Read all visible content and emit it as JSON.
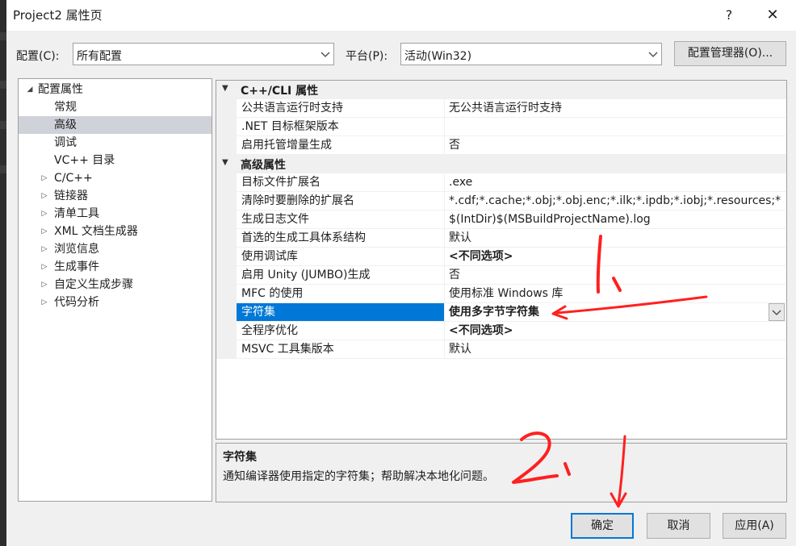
{
  "window": {
    "title": "Project2 属性页",
    "help_label": "?",
    "close_label": "✕"
  },
  "config_bar": {
    "config_label": "配置(C):",
    "config_value": "所有配置",
    "platform_label": "平台(P):",
    "platform_value": "活动(Win32)",
    "manager_button": "配置管理器(O)..."
  },
  "tree": {
    "root": "配置属性",
    "items": [
      {
        "label": "常规"
      },
      {
        "label": "高级"
      },
      {
        "label": "调试"
      },
      {
        "label": "VC++ 目录"
      },
      {
        "label": "C/C++"
      },
      {
        "label": "链接器"
      },
      {
        "label": "清单工具"
      },
      {
        "label": "XML 文档生成器"
      },
      {
        "label": "浏览信息"
      },
      {
        "label": "生成事件"
      },
      {
        "label": "自定义生成步骤"
      },
      {
        "label": "代码分析"
      }
    ]
  },
  "grid": {
    "sections": [
      {
        "title": "C++/CLI 属性",
        "rows": [
          {
            "name": "公共语言运行时支持",
            "value": "无公共语言运行时支持"
          },
          {
            "name": ".NET 目标框架版本",
            "value": ""
          },
          {
            "name": "启用托管增量生成",
            "value": "否"
          }
        ]
      },
      {
        "title": "高级属性",
        "rows": [
          {
            "name": "目标文件扩展名",
            "value": ".exe"
          },
          {
            "name": "清除时要删除的扩展名",
            "value": "*.cdf;*.cache;*.obj;*.obj.enc;*.ilk;*.ipdb;*.iobj;*.resources;*"
          },
          {
            "name": "生成日志文件",
            "value": "$(IntDir)$(MSBuildProjectName).log"
          },
          {
            "name": "首选的生成工具体系结构",
            "value": "默认"
          },
          {
            "name": "使用调试库",
            "value": "<不同选项>"
          },
          {
            "name": "启用 Unity (JUMBO)生成",
            "value": "否"
          },
          {
            "name": "MFC 的使用",
            "value": "使用标准 Windows 库"
          },
          {
            "name": "字符集",
            "value": "使用多字节字符集"
          },
          {
            "name": "全程序优化",
            "value": "<不同选项>"
          },
          {
            "name": "MSVC 工具集版本",
            "value": "默认"
          }
        ]
      }
    ]
  },
  "description": {
    "title": "字符集",
    "text": "通知编译器使用指定的字符集；帮助解决本地化问题。"
  },
  "buttons": {
    "ok": "确定",
    "cancel": "取消",
    "apply": "应用(A)"
  },
  "colors": {
    "selection": "#0078d7",
    "annotation": "#ff2020"
  }
}
